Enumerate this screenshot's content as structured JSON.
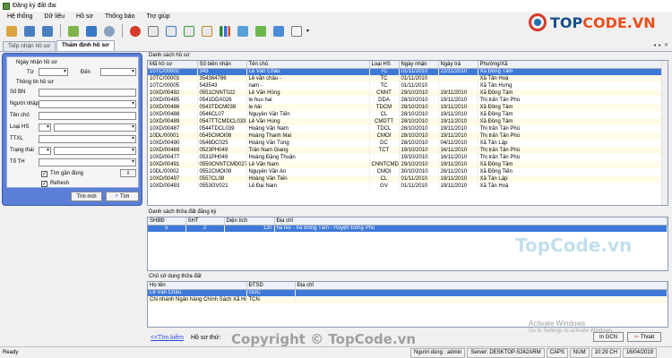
{
  "window": {
    "title": "Đăng ký đất đai"
  },
  "menu": [
    "Hệ thống",
    "Dữ liệu",
    "Hồ sơ",
    "Thống báo",
    "Trợ giúp"
  ],
  "toolbar_icons": [
    "open-icon",
    "export-xml-icon",
    "import-xml-icon",
    "new-record-icon",
    "truck-icon",
    "settings-icon",
    "stop-icon",
    "document-icon",
    "edit-document-icon",
    "approve-document-icon",
    "checklist-icon",
    "bar-chart-icon",
    "image-icon",
    "map-icon",
    "chart-icon",
    "mail-icon"
  ],
  "brand": {
    "text_a": "TOP",
    "text_b": "CODE.VN"
  },
  "tabs": [
    "Tiếp nhận hồ sơ",
    "Thẩm định hồ sơ"
  ],
  "search": {
    "date_label": "Ngày nhận hồ sơ",
    "from_label": "Từ",
    "to_label": "Đến",
    "info_label": "Thông tin hồ sơ",
    "so_bn_label": "Số BN",
    "nguoi_nhap_label": "Người nhập",
    "ten_chu_label": "Tên chủ",
    "loai_hs_label": "Loại HS",
    "ttxl_label": "TTXL",
    "trang_thai_label": "Trạng thái",
    "to_th_label": "Tổ TH",
    "tim_gan_dung_label": "Tìm gần đúng",
    "refresh_label": "Refresh",
    "tim_moi_label": "Tìm mới",
    "tim_label": "Tìm"
  },
  "records": {
    "section_title": "Danh sách hồ sơ",
    "columns": [
      "Mã hồ sơ",
      "Số biên nhận",
      "Tên chủ",
      "Loại HS",
      "Ngày nhận",
      "Ngày trả",
      "Phường/Xã"
    ],
    "rows": [
      [
        "10TC/00002",
        "343",
        "Lê Văn Châu",
        "TC",
        "01/11/2010",
        "22/11/2010",
        "Xã Đồng Tâm"
      ],
      [
        "10TC/00003",
        "354364786",
        "Lê văn châu -",
        "TC",
        "01/11/2010",
        "",
        "Xã Tân Hoà"
      ],
      [
        "10TC/00005",
        "543543",
        "nam -",
        "TC",
        "01/11/2010",
        "",
        "Xã Tân Hưng"
      ],
      [
        "10XD/00492",
        "0551CNNT022",
        "Lê Văn Hồng",
        "CNNT",
        "29/10/2010",
        "19/11/2010",
        "Xã Đồng Tâm"
      ],
      [
        "10XD/00485",
        "0541DDA026",
        "le huu hai",
        "DDA",
        "28/10/2010",
        "19/11/2010",
        "Thị trấn Tân Phú"
      ],
      [
        "10XD/00486",
        "0543TDCM038",
        "le hải",
        "TDCM",
        "28/10/2010",
        "19/11/2010",
        "Xã Đồng Tâm"
      ],
      [
        "10XD/00488",
        "0546CL07",
        "Nguyễn Văn Tiến",
        "CL",
        "28/10/2010",
        "19/11/2010",
        "Xã Đồng Tâm"
      ],
      [
        "10XD/00489",
        "0547TTCMDCL033",
        "Lê Văn Hùng",
        "CMDTT",
        "28/10/2010",
        "19/11/2010",
        "Xã Đồng Tâm"
      ],
      [
        "10XD/00487",
        "0544TDCL039",
        "Hoàng Văn Nam",
        "TDCL",
        "28/10/2010",
        "19/11/2010",
        "Thị trấn Tân Phú"
      ],
      [
        "10DL/00001",
        "0545CMOI08",
        "Hoàng Thanh Mai",
        "CMOI",
        "28/10/2010",
        "19/11/2010",
        "Thị trấn Tân Phú"
      ],
      [
        "10XD/00490",
        "0548DC025",
        "Hoàng Văn Tùng",
        "DC",
        "28/10/2010",
        "04/11/2010",
        "Xã Tân Lập"
      ],
      [
        "10XD/00469",
        "0523PH049",
        "Trần Nam Giang",
        "TCT",
        "19/10/2010",
        "16/11/2010",
        "Thị trấn Tân Phú"
      ],
      [
        "10XD/00477",
        "0531PH049",
        "Hoàng Đăng Thuận",
        "",
        "19/10/2010",
        "16/11/2010",
        "Thị trấn Tân Phú"
      ],
      [
        "10XD/00491",
        "0550CNNTCMD027",
        "Lê Văn Nam",
        "CNNTCMD",
        "29/10/2010",
        "19/11/2010",
        "Xã Đồng Tâm"
      ],
      [
        "10DL/00002",
        "0552CMOI09",
        "Nguyễn Văn An",
        "CMOI",
        "30/10/2010",
        "26/11/2010",
        "Xã Đồng Tiến"
      ],
      [
        "10XD/00497",
        "0557CL08",
        "Hoàng Văn Tiến",
        "CL",
        "01/11/2010",
        "19/11/2010",
        "Xã Tân Lập"
      ],
      [
        "10XD/00493",
        "0553GV021",
        "Lê Đại Nam",
        "GV",
        "01/11/2010",
        "19/11/2010",
        "Xã Tân Hoà"
      ]
    ]
  },
  "parcels": {
    "section_title": "Danh sách thửa đất đăng ký",
    "columns": [
      "SHBĐ",
      "SHT",
      "Diện tích",
      "Địa chỉ"
    ],
    "rows": [
      [
        "5",
        "2",
        "120",
        "ha noi - Xã Đồng Tâm - Huyện Đồng Phú"
      ]
    ]
  },
  "owners": {
    "section_title": "Chủ sử dụng thửa đất",
    "columns": [
      "Họ tên",
      "ĐTSD",
      "Địa chỉ"
    ],
    "rows": [
      [
        "Lê Văn Châu",
        "GDC",
        ""
      ],
      [
        "Chi nhánh Ngân hàng Chính Sách Xã Hội",
        "TCN",
        ""
      ]
    ]
  },
  "bottom": {
    "back_link": "<<Tìm kiếm",
    "record_label": "Hồ sơ thứ:",
    "in_gcn": "In GCN",
    "thoat": "Thoát"
  },
  "status": {
    "ready": "Ready",
    "user": "Người dùng : admin",
    "server": "Server: DESKTOP-5242ARM",
    "caps": "CAPS",
    "num": "NUM",
    "time": "10:29 CH",
    "date": "16/04/2019"
  },
  "overlay": {
    "copyright": "Copyright © TopCode.vn",
    "watermark": "TopCode.vn",
    "activate_title": "Activate Windows",
    "activate_sub": "Go to Settings to activate Windows."
  }
}
